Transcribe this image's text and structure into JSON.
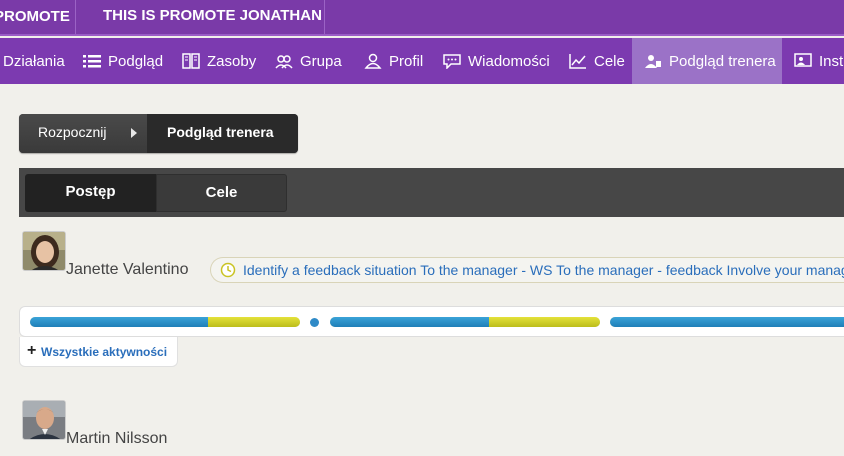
{
  "topbar": {
    "brand": "PROMOTE",
    "headline": "THIS IS PROMOTE JONATHAN"
  },
  "nav": {
    "items": [
      {
        "label": "Działania",
        "icon": "none"
      },
      {
        "label": "Podgląd",
        "icon": "list-icon"
      },
      {
        "label": "Zasoby",
        "icon": "book-icon"
      },
      {
        "label": "Grupa",
        "icon": "group-icon"
      },
      {
        "label": "Profil",
        "icon": "person-icon"
      },
      {
        "label": "Wiadomości",
        "icon": "chat-icon"
      },
      {
        "label": "Cele",
        "icon": "chart-icon"
      },
      {
        "label": "Podgląd trenera",
        "icon": "trainer-icon",
        "active": true
      },
      {
        "label": "Instr",
        "icon": "presentation-icon"
      }
    ]
  },
  "breadcrumb": {
    "start": "Rozpocznij",
    "current": "Podgląd trenera"
  },
  "tabs": {
    "progress": "Postęp",
    "goals": "Cele"
  },
  "people": [
    {
      "name": "Janette Valentino",
      "activity": "Identify a feedback situation To the manager - WS To the manager - feedback Involve your manager",
      "progress": [
        {
          "blue": 0.66,
          "yellow": 0.34
        },
        {
          "blue": 0.59,
          "yellow": 0.41
        },
        {
          "blue": 1.0,
          "yellow": 0.0
        }
      ],
      "all_activities_label": "Wszystkie aktywności"
    },
    {
      "name": "Martin Nilsson"
    }
  ],
  "colors": {
    "topbar": "#7a3aa8",
    "nav": "#7c3ab0",
    "nav_active": "#9b72c7",
    "link": "#2a6ebb",
    "progress_blue": "#2a8fcb",
    "progress_yellow": "#d3d42a"
  }
}
